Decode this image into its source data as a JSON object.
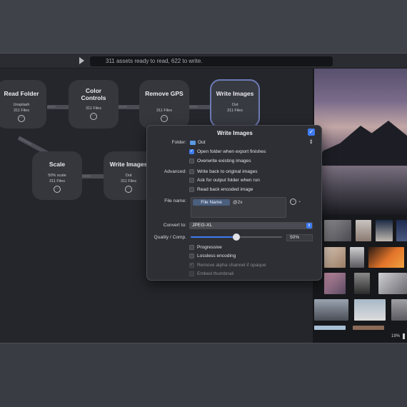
{
  "toolbar": {
    "status": "311 assets ready to read, 622 to write."
  },
  "nodes": {
    "read_folder": {
      "title": "Read Folder",
      "subtitle": "Unsplash",
      "count": "311 Files"
    },
    "color_controls": {
      "title": "Color Controls",
      "count": "311 Files"
    },
    "remove_gps": {
      "title": "Remove GPS",
      "count": "311 Files"
    },
    "write_images_top": {
      "title": "Write Images",
      "subtitle": "Out",
      "count": "311 Files"
    },
    "scale": {
      "title": "Scale",
      "subtitle": "50% scale",
      "count": "311 Files"
    },
    "write_images_bottom": {
      "title": "Write Images",
      "subtitle": "Out",
      "count": "311 Files"
    },
    "menu_glyph": "···"
  },
  "panel": {
    "title": "Write Images",
    "folder_label": "Folder:",
    "folder_value": "Out",
    "open_folder": "Open folder when export finishes",
    "overwrite": "Overwrite existing images",
    "advanced_label": "Advanced:",
    "write_back": "Write back to original images",
    "ask_output": "Ask for output folder when run",
    "read_back": "Read back encoded image",
    "filename_label": "File name:",
    "filename_token": "File Name",
    "filename_suffix": "@2x",
    "convert_label": "Convert to:",
    "convert_value": "JPEG-XL",
    "quality_label": "Quality / Comp.",
    "quality_value": "50%",
    "quality_fraction": 0.5,
    "progressive": "Progressive",
    "lossless": "Lossless encoding",
    "remove_alpha": "Remove alpha channel if opaque",
    "embed_thumb": "Embed thumbnail"
  },
  "preview": {
    "zoom": "19%"
  },
  "colors": {
    "accent": "#3e7bf2",
    "canvas": "#25262b",
    "panel": "#2e2f35",
    "node": "#35373d"
  }
}
